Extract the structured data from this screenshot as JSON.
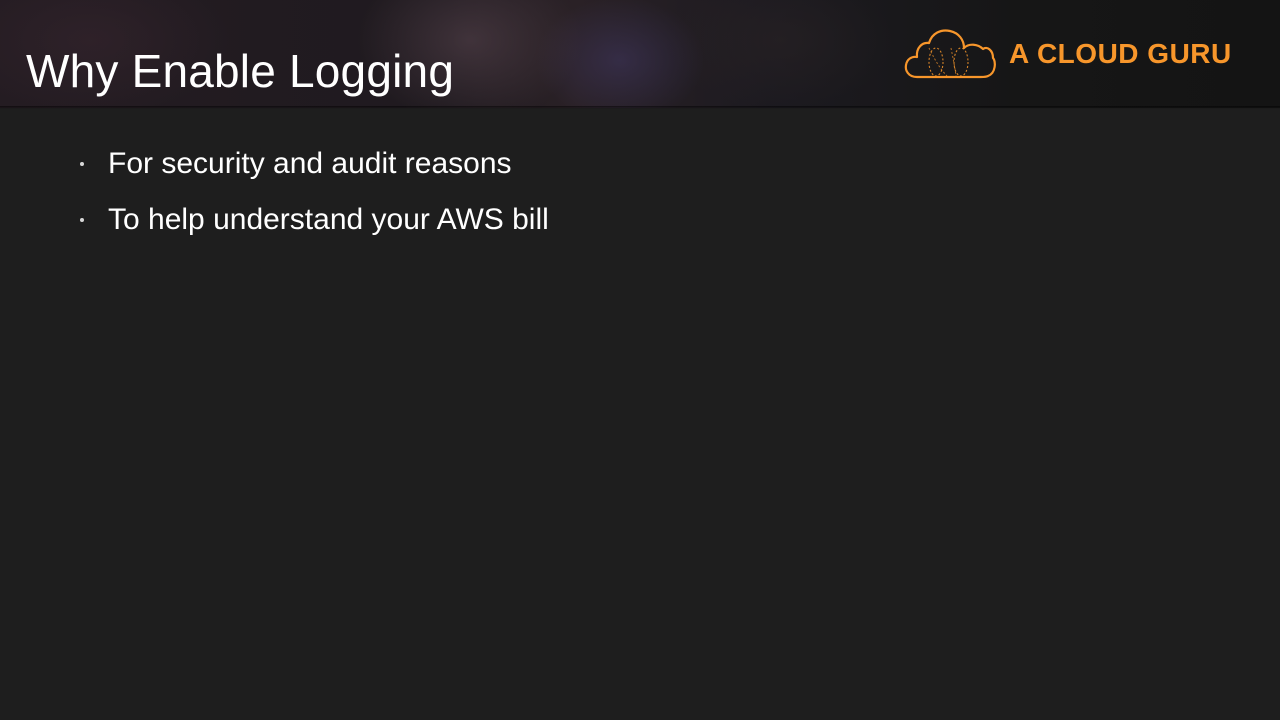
{
  "slide": {
    "title": "Why Enable Logging",
    "logo": {
      "icon": "cloud-icon",
      "text": "A CLOUD GURU",
      "accent_color": "#f7962b"
    },
    "bullets": [
      {
        "text": "For security and audit reasons"
      },
      {
        "text": "To help understand your AWS bill"
      }
    ],
    "colors": {
      "background": "#1e1e1e",
      "title": "#ffffff",
      "body_text": "#ffffff"
    }
  }
}
